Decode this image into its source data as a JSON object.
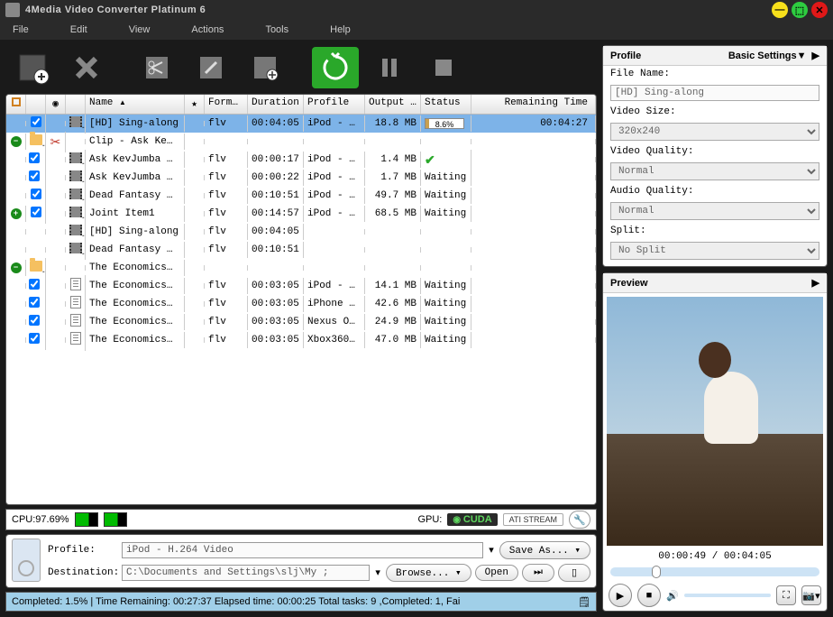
{
  "title": "4Media Video Converter Platinum 6",
  "menu": [
    "File",
    "Edit",
    "View",
    "Actions",
    "Tools",
    "Help"
  ],
  "columns": [
    "",
    "",
    "",
    "",
    "Name",
    "",
    "Format",
    "Duration",
    "Profile",
    "Output Size",
    "Status",
    "Remaining Time"
  ],
  "rows": [
    {
      "exp": "",
      "chk": true,
      "ico": "film",
      "name": "[HD] Sing-along",
      "fmt": "flv",
      "dur": "00:04:05",
      "prof": "iPod - H…",
      "size": "18.8 MB",
      "status": "progress",
      "pct": "8.6%",
      "rem": "00:04:27",
      "sel": true
    },
    {
      "exp": "minus",
      "chk": "",
      "ico": "folder",
      "name": "Clip - Ask Ke…",
      "fmt": "",
      "dur": "",
      "prof": "",
      "size": "",
      "status": "",
      "rem": "",
      "sci": true
    },
    {
      "exp": "",
      "chk": true,
      "ico": "film",
      "name": "Ask KevJumba …",
      "fmt": "flv",
      "dur": "00:00:17",
      "prof": "iPod - H…",
      "size": "1.4 MB",
      "status": "done",
      "rem": "",
      "indent": 1
    },
    {
      "exp": "",
      "chk": true,
      "ico": "film",
      "name": "Ask KevJumba …",
      "fmt": "flv",
      "dur": "00:00:22",
      "prof": "iPod - H…",
      "size": "1.7 MB",
      "status": "Waiting",
      "rem": "",
      "indent": 1
    },
    {
      "exp": "",
      "chk": true,
      "ico": "film",
      "name": "Dead Fantasy …",
      "fmt": "flv",
      "dur": "00:10:51",
      "prof": "iPod - H…",
      "size": "49.7 MB",
      "status": "Waiting",
      "rem": ""
    },
    {
      "exp": "plus",
      "chk": true,
      "ico": "film",
      "name": "Joint Item1",
      "fmt": "flv",
      "dur": "00:14:57",
      "prof": "iPod - H…",
      "size": "68.5 MB",
      "status": "Waiting",
      "rem": ""
    },
    {
      "exp": "",
      "chk": "",
      "ico": "film",
      "name": "[HD] Sing-along",
      "fmt": "flv",
      "dur": "00:04:05",
      "prof": "",
      "size": "",
      "status": "",
      "rem": "",
      "indent": 1
    },
    {
      "exp": "",
      "chk": "",
      "ico": "film",
      "name": "Dead Fantasy …",
      "fmt": "flv",
      "dur": "00:10:51",
      "prof": "",
      "size": "",
      "status": "",
      "rem": "",
      "indent": 1
    },
    {
      "exp": "minus",
      "chk": "",
      "ico": "folder",
      "name": "The Economics…",
      "fmt": "",
      "dur": "",
      "prof": "",
      "size": "",
      "status": "",
      "rem": ""
    },
    {
      "exp": "",
      "chk": true,
      "ico": "doc",
      "name": "The Economics…",
      "fmt": "flv",
      "dur": "00:03:05",
      "prof": "iPod - H…",
      "size": "14.1 MB",
      "status": "Waiting",
      "rem": "",
      "indent": 1
    },
    {
      "exp": "",
      "chk": true,
      "ico": "doc",
      "name": "The Economics…",
      "fmt": "flv",
      "dur": "00:03:05",
      "prof": "iPhone -…",
      "size": "42.6 MB",
      "status": "Waiting",
      "rem": "",
      "indent": 1
    },
    {
      "exp": "",
      "chk": true,
      "ico": "doc",
      "name": "The Economics…",
      "fmt": "flv",
      "dur": "00:03:05",
      "prof": "Nexus On…",
      "size": "24.9 MB",
      "status": "Waiting",
      "rem": "",
      "indent": 1
    },
    {
      "exp": "",
      "chk": true,
      "ico": "doc",
      "name": "The Economics…",
      "fmt": "flv",
      "dur": "00:03:05",
      "prof": "Xbox360 …",
      "size": "47.0 MB",
      "status": "Waiting",
      "rem": "",
      "indent": 1
    }
  ],
  "cpu": {
    "label": "CPU:97.69%",
    "gpu": "GPU:",
    "cuda": "CUDA",
    "ati": "ATI STREAM"
  },
  "profile": {
    "label": "Profile:",
    "value": "iPod - H.264 Video",
    "save": "Save As... ▾"
  },
  "dest": {
    "label": "Destination:",
    "value": "C:\\Documents and Settings\\slj\\My ;",
    "browse": "Browse... ▾",
    "open": "Open"
  },
  "status": "Completed: 1.5% | Time Remaining: 00:27:37 Elapsed time: 00:00:25 Total tasks: 9 ,Completed: 1, Fai",
  "side": {
    "profileTitle": "Profile",
    "basic": "Basic Settings▼",
    "fileNameL": "File Name:",
    "fileName": "[HD] Sing-along",
    "videoSizeL": "Video Size:",
    "videoSize": "320x240",
    "videoQL": "Video Quality:",
    "videoQ": "Normal",
    "audioQL": "Audio Quality:",
    "audioQ": "Normal",
    "splitL": "Split:",
    "split": "No Split",
    "previewTitle": "Preview",
    "time": "00:00:49 / 00:04:05"
  }
}
